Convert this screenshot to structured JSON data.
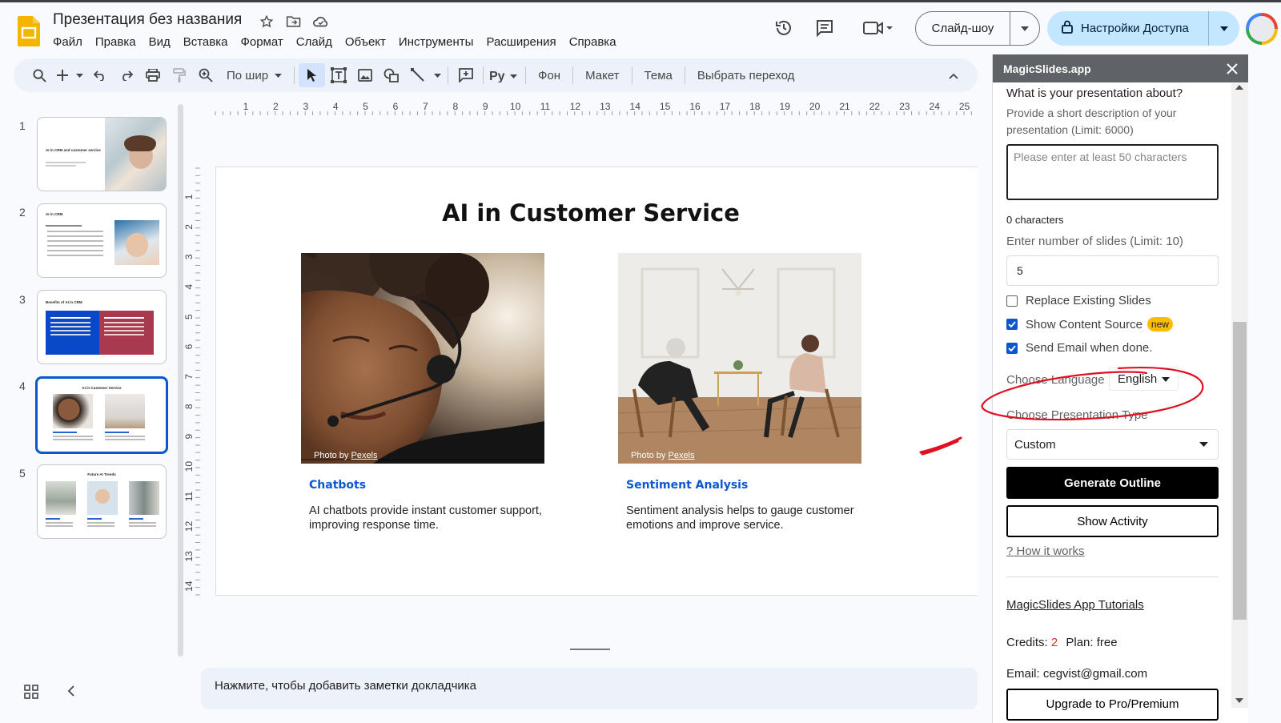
{
  "header": {
    "doc_title": "Презентация без названия",
    "menu": [
      "Файл",
      "Правка",
      "Вид",
      "Вставка",
      "Формат",
      "Слайд",
      "Объект",
      "Инструменты",
      "Расширения",
      "Справка"
    ],
    "slideshow_label": "Слайд-шоу",
    "share_label": "Настройки Доступа"
  },
  "toolbar": {
    "zoom_label": "По шир",
    "background_label": "Фон",
    "layout_label": "Макет",
    "theme_label": "Тема",
    "transition_label": "Выбрать переход"
  },
  "filmstrip": {
    "slides": [
      {
        "num": "1",
        "title": "AI in CRM and customer service"
      },
      {
        "num": "2",
        "title": "AI in CRM"
      },
      {
        "num": "3",
        "title": "Benefits of AI in CRM"
      },
      {
        "num": "4",
        "title": "AI in Customer Service"
      },
      {
        "num": "5",
        "title": "Future AI Trends"
      }
    ],
    "active_index": 4
  },
  "ruler": {
    "h_ticks": [
      "1",
      "2",
      "3",
      "4",
      "5",
      "6",
      "7",
      "8",
      "9",
      "10",
      "11",
      "12",
      "13",
      "14",
      "15",
      "16",
      "17",
      "18",
      "19",
      "20",
      "21",
      "22",
      "23",
      "24",
      "25"
    ],
    "v_ticks": [
      "1",
      "2",
      "3",
      "4",
      "5",
      "6",
      "7",
      "8",
      "9",
      "10",
      "11",
      "12",
      "13",
      "14"
    ]
  },
  "slide": {
    "title": "AI in Customer Service",
    "cards": [
      {
        "heading": "Chatbots",
        "body": "AI chatbots provide instant customer support, improving response time.",
        "credit_prefix": "Photo by ",
        "credit_link": "Pexels"
      },
      {
        "heading": "Sentiment Analysis",
        "body": "Sentiment analysis helps to gauge customer emotions and improve service.",
        "credit_prefix": "Photo by ",
        "credit_link": "Pexels"
      }
    ]
  },
  "notes": {
    "placeholder": "Нажмите, чтобы добавить заметки докладчика"
  },
  "panel": {
    "title": "MagicSlides.app",
    "question": "What is your presentation about?",
    "hint": "Provide a short description of your presentation (Limit: 6000)",
    "textarea_placeholder": "Please enter at least 50 characters",
    "char_count": "0 characters",
    "slides_label": "Enter number of slides (Limit: 10)",
    "slides_value": "5",
    "replace_label": "Replace Existing Slides",
    "replace_checked": false,
    "content_source_label": "Show Content Source",
    "content_source_checked": true,
    "new_badge": "new",
    "send_email_label": "Send Email when done.",
    "send_email_checked": true,
    "language_label": "Choose Language",
    "language_value": "English",
    "type_label": "Choose Presentation Type",
    "type_value": "Custom",
    "generate_label": "Generate Outline",
    "activity_label": "Show Activity",
    "how_link": "? How it works",
    "tutorials_link": "MagicSlides App Tutorials",
    "credits_label": "Credits:",
    "credits_value": "2",
    "plan_label": "Plan:",
    "plan_value": "free",
    "email_label": "Email:",
    "email_value": "cegvist@gmail.com",
    "upgrade_label": "Upgrade to Pro/Premium"
  },
  "colors": {
    "accent_blue": "#0b57d0",
    "share_bg": "#c2e7ff",
    "annotation_red": "#e01020",
    "credits_red": "#d93025",
    "slides_logo": "#f4b400"
  }
}
